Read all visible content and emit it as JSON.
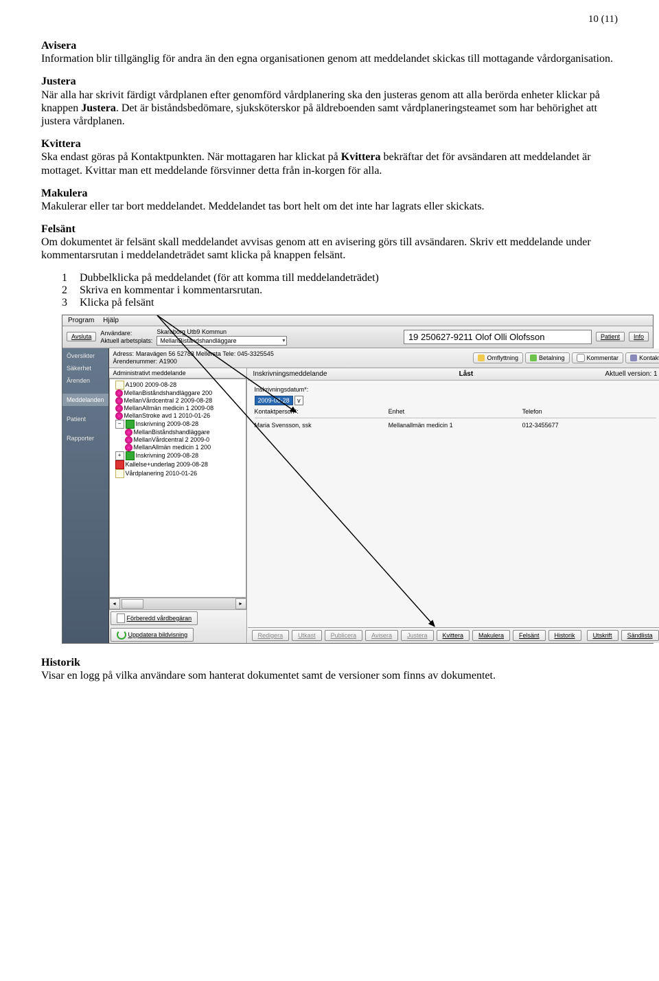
{
  "page_number": "10 (11)",
  "sections": {
    "avisera": {
      "title": "Avisera",
      "body": "Information blir tillgänglig för andra än den egna organisationen genom att meddelandet skickas till mottagande vårdorganisation."
    },
    "justera": {
      "title": "Justera",
      "body1": "När alla har skrivit färdigt vårdplanen efter genomförd vårdplanering ska den justeras genom att alla berörda enheter klickar på knappen ",
      "bold": "Justera",
      "body2": ". Det är biståndsbedömare, sjuksköterskor på äldreboenden samt vårdplaneringsteamet som har behörighet att justera vårdplanen."
    },
    "kvittera": {
      "title": "Kvittera",
      "body1": "Ska endast göras på Kontaktpunkten. När mottagaren har klickat på ",
      "bold": "Kvittera",
      "body2": " bekräftar det för avsändaren att meddelandet är mottaget. Kvittar man ett meddelande försvinner detta från in-korgen för alla."
    },
    "makulera": {
      "title": "Makulera",
      "body": "Makulerar eller tar bort meddelandet. Meddelandet tas bort helt om det inte har lagrats eller skickats."
    },
    "felsant": {
      "title": "Felsänt",
      "body": "Om dokumentet är felsänt skall meddelandet avvisas genom att en avisering görs till avsändaren. Skriv ett meddelande under kommentarsrutan i meddelandeträdet samt klicka på knappen felsänt.",
      "list": [
        "Dubbelklicka på meddelandet (för att komma till meddelandeträdet)",
        "Skriva en kommentar i kommentarsrutan.",
        "Klicka på felsänt"
      ]
    },
    "historik": {
      "title": "Historik",
      "body": "Visar en logg på vilka användare som hanterat dokumentet samt de versioner som finns av dokumentet."
    }
  },
  "app": {
    "menus": {
      "program": "Program",
      "help": "Hjälp"
    },
    "avsluta": "Avsluta",
    "user_label": "Användare:",
    "user_value": "Skaraborg Utb9 Kommun",
    "workplace_label": "Aktuell arbetsplats:",
    "workplace_value": "MellanBiståndshandläggare",
    "patient": "19 250627-9211 Olof Olli Olofsson",
    "btn_patient": "Patient",
    "btn_info": "Info",
    "sidebar": [
      "Översikter",
      "Säkerhet",
      "Ärenden",
      "Meddelanden",
      "Patient",
      "Rapporter"
    ],
    "address_label": "Adress:",
    "address_value": "Maravägen 56 52783 Mellersta Tele: 045-3325545",
    "caseno_label": "Ärendenummer:",
    "caseno_value": "A1900",
    "pills": {
      "omflyttning": "Omflyttning",
      "betalning": "Betalning",
      "kommentar": "Kommentar",
      "kontakter": "Kontakter"
    },
    "tree_tab": "Administrativt meddelande",
    "tree": [
      "A1900 2009-08-28",
      "MellanBiståndshandläggare 200",
      "MellanVårdcentral 2 2009-08-28",
      "MellanAllmän medicin 1 2009-08",
      "MellanStroke avd 1 2010-01-26",
      "Inskrivning 2009-08-28",
      "MellanBiståndshandläggare",
      "MellanVårdcentral 2 2009-0",
      "MellanAllmän medicin 1 200",
      "Inskrivning 2009-08-28",
      "Kallelse+underlag 2009-08-28",
      "Vårdplanering 2010-01-26"
    ],
    "forebered": "Förberedd vårdbegäran",
    "uppdatera": "Uppdatera bildvisning",
    "content_title": "Inskrivningsmeddelande",
    "locked": "Låst",
    "version": "Aktuell version: 1",
    "form": {
      "inskriv_label": "Inskrivningsdatum*:",
      "inskriv_value": "2009-08-28",
      "kontakt_label": "Kontaktperson*:",
      "kontakt_value": "Maria Svensson, ssk",
      "enhet_label": "Enhet",
      "enhet_value": "Mellanallmän medicin 1",
      "telefon_label": "Telefon",
      "telefon_value": "012-3455677"
    },
    "bottom_buttons": [
      "Redigera",
      "Utkast",
      "Publicera",
      "Avisera",
      "Justera",
      "Kvittera",
      "Makulera",
      "Felsänt",
      "Historik"
    ],
    "bottom_right": [
      "Utskrift",
      "Sändlista"
    ]
  }
}
